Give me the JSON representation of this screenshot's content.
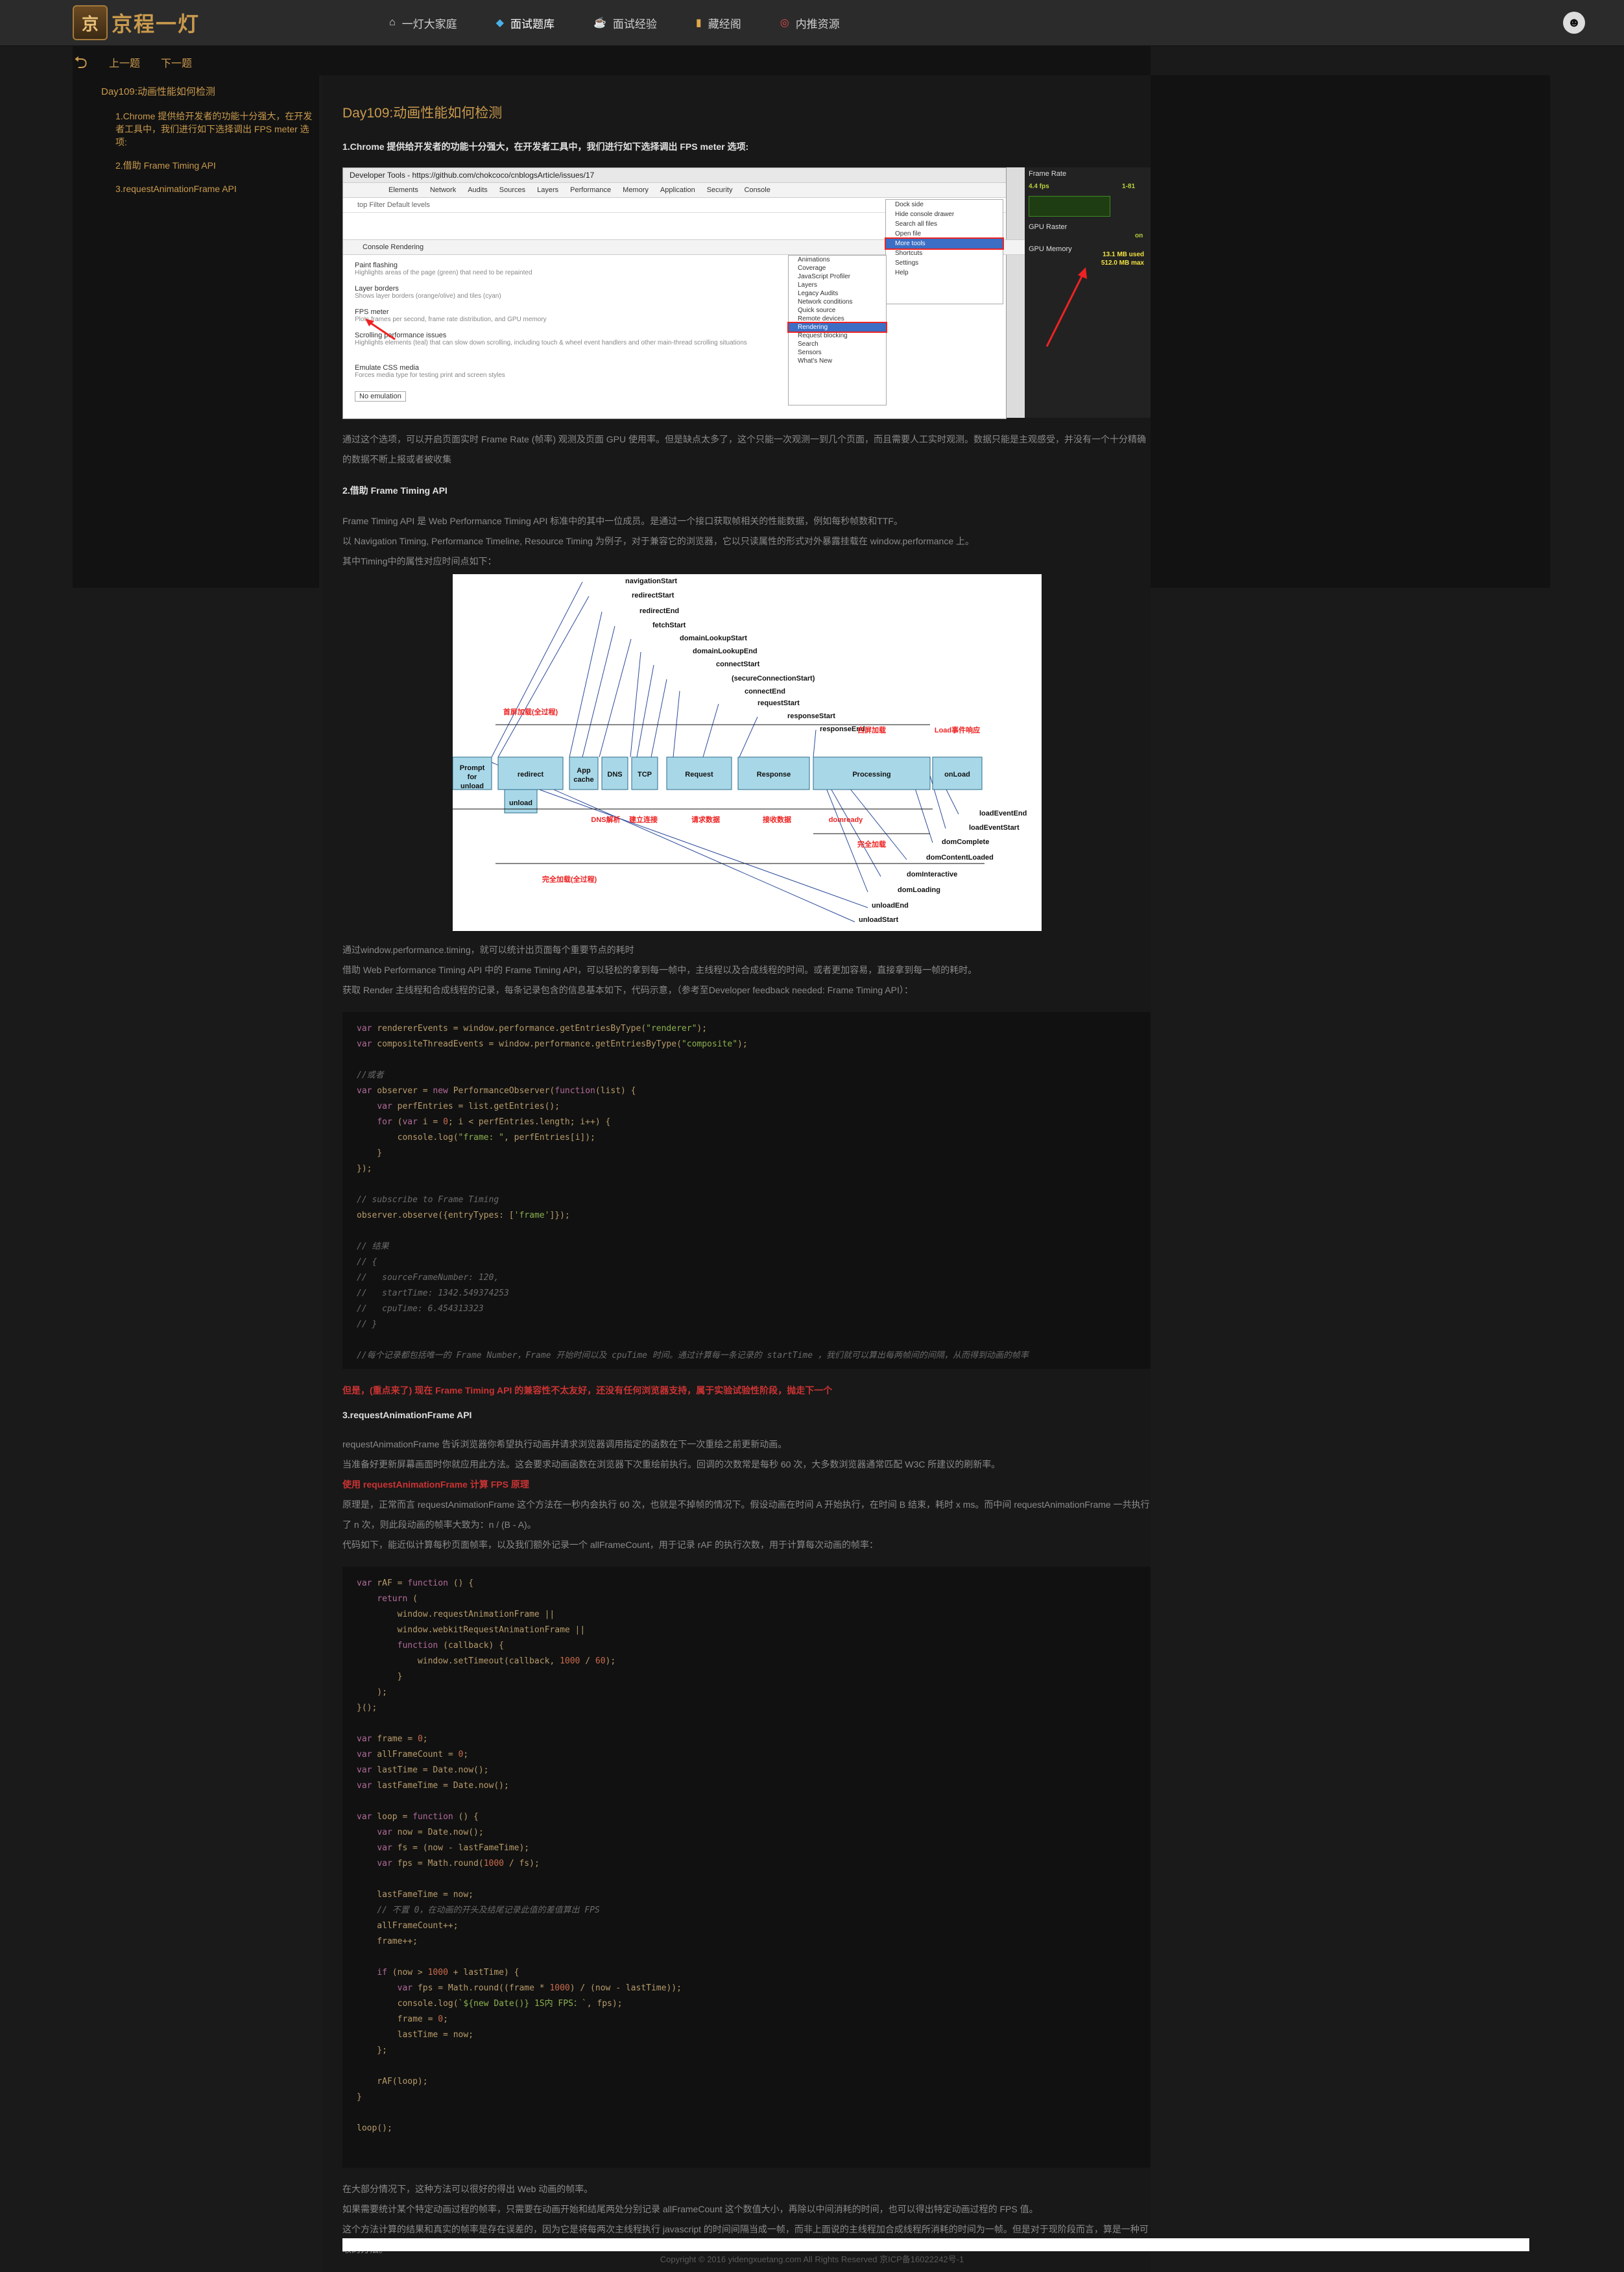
{
  "header": {
    "logo_mark": "京",
    "logo_text": "京程一灯",
    "nav": [
      {
        "label": "一灯大家庭",
        "icon": "home-icon"
      },
      {
        "label": "面试题库",
        "icon": "diamond-icon"
      },
      {
        "label": "面试经验",
        "icon": "cup-icon"
      },
      {
        "label": "藏经阁",
        "icon": "book-icon"
      },
      {
        "label": "内推资源",
        "icon": "target-icon"
      }
    ]
  },
  "subnav": {
    "prev": "上一题",
    "next": "下一题"
  },
  "toc": {
    "title": "Day109:动画性能如何检测",
    "items": [
      "1.Chrome 提供给开发者的功能十分强大，在开发者工具中，我们进行如下选择调出 FPS meter 选项:",
      "2.借助 Frame Timing API",
      "3.requestAnimationFrame API"
    ]
  },
  "article": {
    "title": "Day109:动画性能如何检测",
    "s1": "1.Chrome 提供给开发者的功能十分强大，在开发者工具中，我们进行如下选择调出 FPS meter 选项:",
    "p1": "通过这个选项，可以开启页面实时 Frame Rate (帧率) 观测及页面 GPU 使用率。但是缺点太多了，这个只能一次观测一到几个页面，而且需要人工实时观测。数据只能是主观感受，并没有一个十分精确的数据不断上报或者被收集",
    "s2": "2.借助 Frame Timing API",
    "p2a": "Frame Timing API 是 Web Performance Timing API 标准中的其中一位成员。是通过一个接口获取帧相关的性能数据，例如每秒帧数和TTF。",
    "p2b": "以 Navigation Timing, Performance Timeline, Resource Timing 为例子，对于兼容它的浏览器，它以只读属性的形式对外暴露挂载在 window.performance 上。",
    "p2c": "其中Timing中的属性对应时间点如下：",
    "p3a": "通过window.performance.timing，就可以统计出页面每个重要节点的耗时",
    "p3b": "借助 Web Performance Timing API 中的 Frame Timing API，可以轻松的拿到每一帧中，主线程以及合成线程的时间。或者更加容易，直接拿到每一帧的耗时。",
    "p3c": "获取 Render 主线程和合成线程的记录，每条记录包含的信息基本如下，代码示意，（参考至Developer feedback needed: Frame Timing API）：",
    "warn": "但是，(重点来了) 现在 Frame Timing API 的兼容性不太友好，还没有任何浏览器支持，属于实验试验性阶段，抛走下一个",
    "s3": "3.requestAnimationFrame API",
    "p4a": "requestAnimationFrame 告诉浏览器你希望执行动画并请求浏览器调用指定的函数在下一次重绘之前更新动画。",
    "p4b": "当准备好更新屏幕画面时你就应用此方法。这会要求动画函数在浏览器下次重绘前执行。回调的次数常是每秒 60 次，大多数浏览器通常匹配 W3C 所建议的刷新率。",
    "p4c": "使用 requestAnimationFrame 计算 FPS 原理",
    "p4d": "原理是，正常而言 requestAnimationFrame 这个方法在一秒内会执行 60 次，也就是不掉帧的情况下。假设动画在时间 A 开始执行，在时间 B 结束，耗时 x ms。而中间 requestAnimationFrame 一共执行了 n 次，则此段动画的帧率大致为：n / (B - A)。",
    "p4e": "代码如下，能近似计算每秒页面帧率，以及我们额外记录一个 allFrameCount，用于记录 rAF 的执行次数，用于计算每次动画的帧率：",
    "p5a": "在大部分情况下，这种方法可以很好的得出 Web 动画的帧率。",
    "p5b": "如果需要统计某个特定动画过程的帧率，只需要在动画开始和结尾两处分别记录 allFrameCount 这个数值大小，再除以中间消耗的时间，也可以得出特定动画过程的 FPS 值。",
    "p5c": "这个方法计算的结果和真实的帧率是存在误差的，因为它是将每两次主线程执行 javascript 的时间间隔当成一帧，而非上面说的主线程加合成线程所消耗的时间为一帧。但是对于现阶段而言，算是一种可取的方法。"
  },
  "devtools": {
    "title": "Developer Tools - https://github.com/chokcoco/cnblogsArticle/issues/17",
    "tabs": [
      "Elements",
      "Network",
      "Audits",
      "Sources",
      "Layers",
      "Performance",
      "Memory",
      "Application",
      "Security",
      "Console"
    ],
    "filter": "top      Filter      Default levels",
    "subtabs": "Console   Rendering",
    "options": [
      {
        "name": "Paint flashing",
        "desc": "Highlights areas of the page (green) that need to be repainted"
      },
      {
        "name": "Layer borders",
        "desc": "Shows layer borders (orange/olive) and tiles (cyan)"
      },
      {
        "name": "FPS meter",
        "desc": "Plots frames per second, frame rate distribution, and GPU memory"
      },
      {
        "name": "Scrolling performance issues",
        "desc": "Highlights elements (teal) that can slow down scrolling, including touch & wheel event handlers and other main-thread scrolling situations"
      },
      {
        "name": "Emulate CSS media",
        "desc": "Forces media type for testing print and screen styles"
      }
    ],
    "emulation": "No emulation",
    "menu": [
      "Dock side",
      "Hide console drawer",
      "Search all files",
      "Open file",
      "More tools",
      "Shortcuts",
      "Settings",
      "Help"
    ],
    "submenu": [
      "Animations",
      "Coverage",
      "JavaScript Profiler",
      "Layers",
      "Legacy Audits",
      "Network conditions",
      "Quick source",
      "Remote devices",
      "Rendering",
      "Request blocking",
      "Search",
      "Sensors",
      "What's New"
    ],
    "fps": {
      "frame_rate": "Frame Rate",
      "fps_val": "4.4 fps",
      "fps_range": "1-81",
      "gpu_raster": "GPU Raster",
      "gpu_raster_val": "on",
      "gpu_memory": "GPU Memory",
      "mem_used": "13.1 MB used",
      "mem_max": "512.0 MB max"
    }
  },
  "timing": {
    "top_labels": [
      "navigationStart",
      "redirectStart",
      "redirectEnd",
      "fetchStart",
      "domainLookupStart",
      "domainLookupEnd",
      "connectStart",
      "(secureConnectionStart)",
      "connectEnd",
      "requestStart",
      "responseStart",
      "responseEnd"
    ],
    "boxes": [
      "Prompt for unload",
      "redirect",
      "unload",
      "App cache",
      "DNS",
      "TCP",
      "Request",
      "Response",
      "Processing",
      "onLoad"
    ],
    "red_labels": [
      "首屏加载(全过程)",
      "白屏加载",
      "Load事件响应",
      "DNS解析",
      "建立连接",
      "请求数据",
      "接收数据",
      "domready",
      "完全加载",
      "完全加载(全过程)"
    ],
    "bottom_labels": [
      "loadEventEnd",
      "loadEventStart",
      "domComplete",
      "domContentLoaded",
      "domInteractive",
      "domLoading",
      "unloadEnd",
      "unloadStart"
    ]
  },
  "footer": {
    "copyright": "Copyright © 2016 yidengxuetang.com All Rights Reserved 京ICP备16022242号-1"
  }
}
